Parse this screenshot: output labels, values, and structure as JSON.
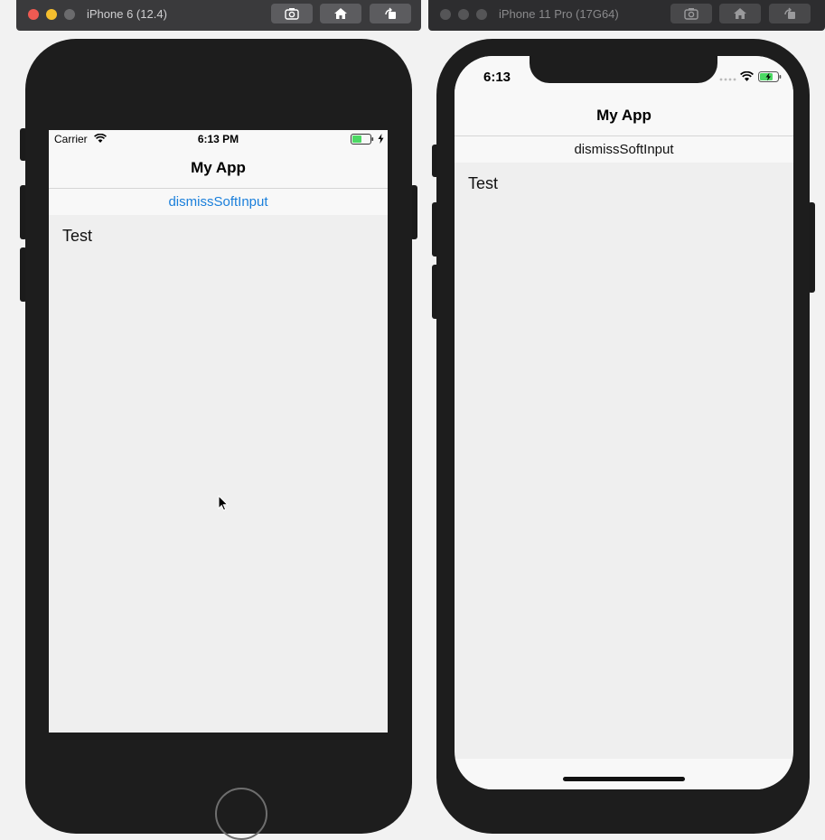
{
  "simulator_left": {
    "window_title": "iPhone 6 (12.4)",
    "traffic_lights": [
      "#ee5a52",
      "#f4be2e",
      "#6b6b6d"
    ],
    "toolbar_icons": [
      "screenshot-icon",
      "home-icon",
      "rotate-icon"
    ],
    "status": {
      "carrier": "Carrier",
      "time": "6:13 PM",
      "battery_color": "#4cd964"
    },
    "app": {
      "nav_title": "My App",
      "dismiss_label": "dismissSoftInput",
      "dismiss_color": "#1a7fdb",
      "body_text": "Test"
    }
  },
  "simulator_right": {
    "window_title": "iPhone 11 Pro (17G64)",
    "traffic_lights": [
      "#555557",
      "#555557",
      "#555557"
    ],
    "toolbar_icons": [
      "screenshot-icon",
      "home-icon",
      "rotate-icon"
    ],
    "status": {
      "time": "6:13",
      "battery_color": "#4cd964"
    },
    "app": {
      "nav_title": "My App",
      "dismiss_label": "dismissSoftInput",
      "dismiss_color": "#111111",
      "body_text": "Test"
    }
  }
}
